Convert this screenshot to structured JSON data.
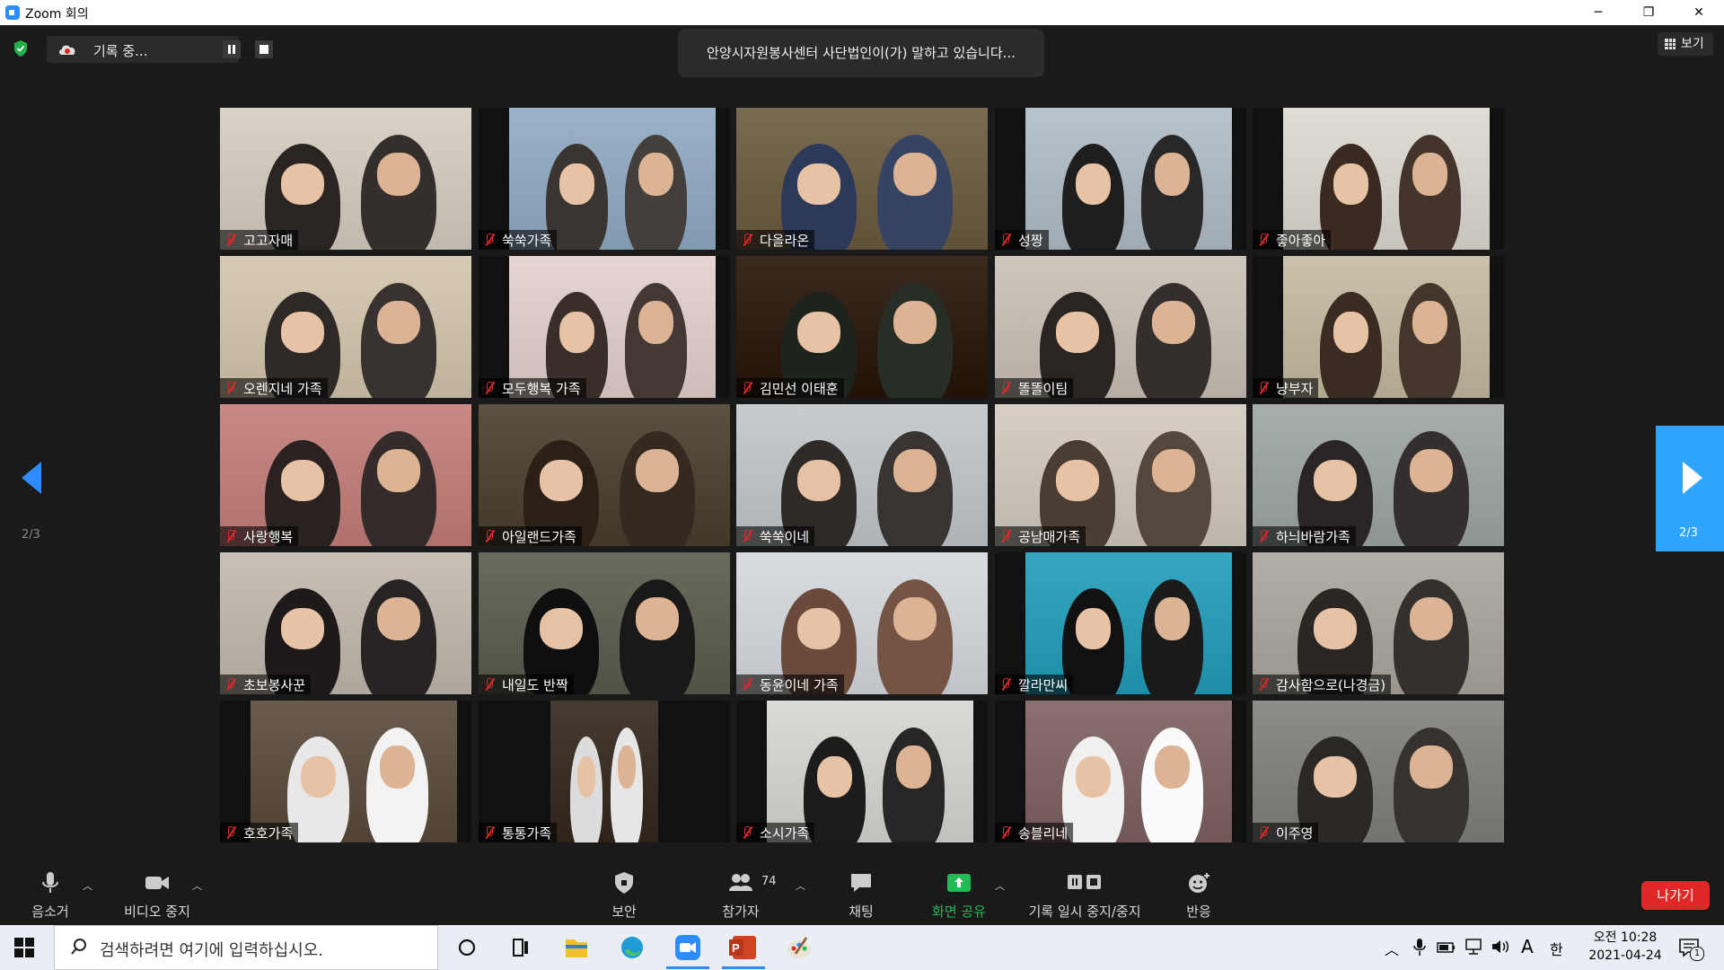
{
  "window": {
    "title": "Zoom 회의",
    "min_label": "─",
    "max_label": "❐",
    "close_label": "✕"
  },
  "recording": {
    "label": "기록 중..."
  },
  "speaking_banner": "안양시자원봉사센터 사단법인이(가) 말하고 있습니다...",
  "view_button": "보기",
  "pagination": {
    "prev_page": "2/3",
    "next_page": "2/3"
  },
  "participants": [
    {
      "name": "고고자매",
      "bg": "#d9d2c6",
      "fig": "#2a2523"
    },
    {
      "name": "쑥쑥가족",
      "bg": "#9ab3c8",
      "fig": "#3a3530"
    },
    {
      "name": "다올라온",
      "bg": "#7a6a52",
      "fig": "#2c3a5a"
    },
    {
      "name": "성짱",
      "bg": "#b9c3cc",
      "fig": "#1e1e1e"
    },
    {
      "name": "좋아좋아",
      "bg": "#e0ddd6",
      "fig": "#3b2a22"
    },
    {
      "name": "오렌지네 가족",
      "bg": "#d8cbb4",
      "fig": "#2e2926"
    },
    {
      "name": "모두행복 가족",
      "bg": "#e6d5d2",
      "fig": "#3a2e2a"
    },
    {
      "name": "김민선 이태훈",
      "bg": "#3a2a20",
      "fig": "#1c241c"
    },
    {
      "name": "똘똘이팀",
      "bg": "#cfc6bd",
      "fig": "#2a2522"
    },
    {
      "name": "냥부자",
      "bg": "#c9c2a8",
      "fig": "#3a2c22"
    },
    {
      "name": "사랑행복",
      "bg": "#c98a86",
      "fig": "#2a2220"
    },
    {
      "name": "아일랜드가족",
      "bg": "#5c5040",
      "fig": "#2a2018"
    },
    {
      "name": "쑥쑥이네",
      "bg": "#c6cccf",
      "fig": "#2f2a28"
    },
    {
      "name": "공남매가족",
      "bg": "#d7cfc6",
      "fig": "#4a3d34"
    },
    {
      "name": "하늬바람가족",
      "bg": "#a7aeae",
      "fig": "#2a2524"
    },
    {
      "name": "초보봉사꾼",
      "bg": "#c8c0b6",
      "fig": "#1e1a1a"
    },
    {
      "name": "내일도 반짝",
      "bg": "#6a6a5e",
      "fig": "#0f0f0f"
    },
    {
      "name": "동윤이네 가족",
      "bg": "#d9dde2",
      "fig": "#6a4a3a"
    },
    {
      "name": "깔라만씨",
      "bg": "#35a7c0",
      "fig": "#111111"
    },
    {
      "name": "감사함으로(나경금)",
      "bg": "#b3aea6",
      "fig": "#2a2624"
    },
    {
      "name": "호호가족",
      "bg": "#6a5c4c",
      "fig": "#e8e8e8"
    },
    {
      "name": "통통가족",
      "bg": "#463c32",
      "fig": "#dcdcdc"
    },
    {
      "name": "소시가족",
      "bg": "#dcdad6",
      "fig": "#1c1c1c"
    },
    {
      "name": "송블리네",
      "bg": "#8a7070",
      "fig": "#f0f0f0"
    },
    {
      "name": "이주영",
      "bg": "#8c8c88",
      "fig": "#2c2826"
    }
  ],
  "toolbar": {
    "mute": "음소거",
    "video": "비디오 중지",
    "security": "보안",
    "participants": "참가자",
    "participants_count": "74",
    "chat": "채팅",
    "share": "화면 공유",
    "record": "기록 일시 중지/중지",
    "reactions": "반응",
    "leave": "나가기"
  },
  "colors": {
    "accent": "#2d8cff",
    "share_green": "#22bb55",
    "leave_red": "#e02828",
    "mic_off_red": "#e02828"
  },
  "taskbar": {
    "search_placeholder": "검색하려면 여기에 입력하십시오.",
    "ime_label": "A",
    "lang_label": "한",
    "clock_time": "오전 10:28",
    "clock_date": "2021-04-24",
    "notif_count": "1",
    "apps": [
      "task-view-icon",
      "file-explorer-icon",
      "edge-icon",
      "zoom-icon",
      "powerpoint-icon",
      "paint-icon"
    ]
  }
}
